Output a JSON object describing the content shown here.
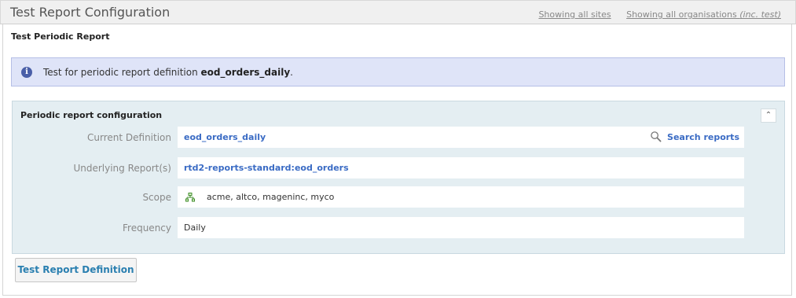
{
  "header": {
    "title": "Test Report Configuration",
    "link_sites": "Showing all sites",
    "link_orgs_prefix": "Showing all organisations ",
    "link_orgs_suffix": "(inc. test)"
  },
  "panel": {
    "title": "Test Periodic Report"
  },
  "info": {
    "prefix": "Test for periodic report definition ",
    "definition": "eod_orders_daily",
    "suffix": "."
  },
  "config": {
    "title": "Periodic report configuration",
    "collapse_glyph": "⌃",
    "rows": [
      {
        "label": "Current Definition",
        "value": "eod_orders_daily"
      },
      {
        "label": "Underlying Report(s)",
        "value": "rtd2-reports-standard:eod_orders"
      },
      {
        "label": "Scope",
        "value": "acme, altco, mageninc, myco"
      },
      {
        "label": "Frequency",
        "value": "Daily"
      }
    ],
    "search_label": "Search reports"
  },
  "actions": {
    "test_label": "Test Report Definition"
  },
  "colors": {
    "link": "#3a6bc4",
    "info_bg": "#dfe4f8",
    "config_bg": "#e4eef2",
    "button_text": "#2a7fb0"
  },
  "icons": {
    "info": "info-icon",
    "search": "search-icon",
    "scope": "org-tree-icon",
    "collapse": "chevron-up-icon"
  }
}
